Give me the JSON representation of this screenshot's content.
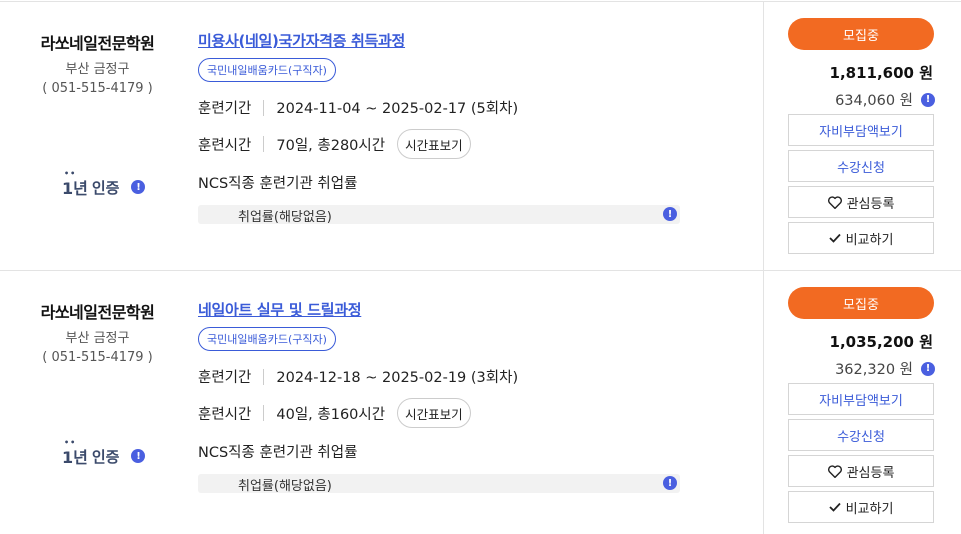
{
  "courses": [
    {
      "institution": "라쏘네일전문학원",
      "region": "부산 금정구",
      "phone": "( 051-515-4179 )",
      "cert_years": "1년",
      "cert_label": "인증",
      "cert_dots": "••",
      "title": "미용사(네일)국가자격증 취득과정",
      "tag": "국민내일배움카드(구직자)",
      "period_label": "훈련기간",
      "period_value": "2024-11-04 ~ 2025-02-17 (5회차)",
      "time_label": "훈련시간",
      "time_value": "70일, 총280시간",
      "timetable_btn": "시간표보기",
      "ncs_text": "NCS직종 훈련기관 취업률",
      "employment_text": "취업률(해당없음)",
      "status": "모집중",
      "price": "1,811,600 원",
      "self_pay": "634,060 원",
      "btn_burden": "자비부담액보기",
      "btn_apply": "수강신청",
      "btn_wish": "관심등록",
      "btn_compare": "비교하기"
    },
    {
      "institution": "라쏘네일전문학원",
      "region": "부산 금정구",
      "phone": "( 051-515-4179 )",
      "cert_years": "1년",
      "cert_label": "인증",
      "cert_dots": "••",
      "title": "네일아트 실무 및 드릴과정",
      "tag": "국민내일배움카드(구직자)",
      "period_label": "훈련기간",
      "period_value": "2024-12-18 ~ 2025-02-19 (3회차)",
      "time_label": "훈련시간",
      "time_value": "40일, 총160시간",
      "timetable_btn": "시간표보기",
      "ncs_text": "NCS직종 훈련기관 취업률",
      "employment_text": "취업률(해당없음)",
      "status": "모집중",
      "price": "1,035,200 원",
      "self_pay": "362,320 원",
      "btn_burden": "자비부담액보기",
      "btn_apply": "수강신청",
      "btn_wish": "관심등록",
      "btn_compare": "비교하기"
    }
  ],
  "info_icon_glyph": "!",
  "colors": {
    "accent": "#f26a22",
    "link": "#3a5bd8",
    "info": "#4a5fe0"
  }
}
